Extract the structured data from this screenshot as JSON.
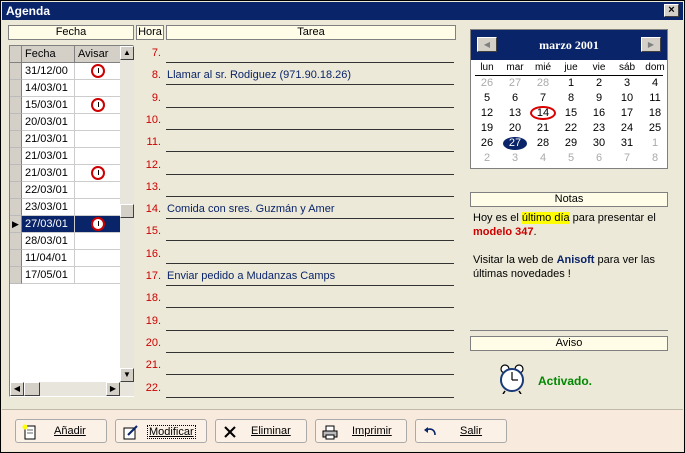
{
  "window": {
    "title": "Agenda",
    "close_label": "×"
  },
  "headers": {
    "fecha": "Fecha",
    "hora": "Hora",
    "tarea": "Tarea",
    "notas": "Notas",
    "aviso": "Aviso"
  },
  "list": {
    "col_fecha": "Fecha",
    "col_avisar": "Avisar",
    "rows": [
      {
        "date": "31/12/00",
        "alarm": true
      },
      {
        "date": "14/03/01",
        "alarm": false
      },
      {
        "date": "15/03/01",
        "alarm": true
      },
      {
        "date": "20/03/01",
        "alarm": false
      },
      {
        "date": "21/03/01",
        "alarm": false
      },
      {
        "date": "21/03/01",
        "alarm": false
      },
      {
        "date": "21/03/01",
        "alarm": true
      },
      {
        "date": "22/03/01",
        "alarm": false
      },
      {
        "date": "23/03/01",
        "alarm": false
      },
      {
        "date": "27/03/01",
        "alarm": true,
        "selected": true
      },
      {
        "date": "28/03/01",
        "alarm": false
      },
      {
        "date": "11/04/01",
        "alarm": false
      },
      {
        "date": "17/05/01",
        "alarm": false
      }
    ]
  },
  "tasks": [
    {
      "hour": "7.",
      "text": ""
    },
    {
      "hour": "8.",
      "text": "Llamar al sr. Rodiguez (971.90.18.26)"
    },
    {
      "hour": "9.",
      "text": ""
    },
    {
      "hour": "10.",
      "text": ""
    },
    {
      "hour": "11.",
      "text": ""
    },
    {
      "hour": "12.",
      "text": ""
    },
    {
      "hour": "13.",
      "text": ""
    },
    {
      "hour": "14.",
      "text": "Comida con sres. Guzmán y Amer"
    },
    {
      "hour": "15.",
      "text": ""
    },
    {
      "hour": "16.",
      "text": ""
    },
    {
      "hour": "17.",
      "text": "Enviar pedido a Mudanzas Camps"
    },
    {
      "hour": "18.",
      "text": ""
    },
    {
      "hour": "19.",
      "text": ""
    },
    {
      "hour": "20.",
      "text": ""
    },
    {
      "hour": "21.",
      "text": ""
    },
    {
      "hour": "22.",
      "text": ""
    }
  ],
  "calendar": {
    "title": "marzo 2001",
    "prev": "◀",
    "next": "▶",
    "dow": [
      "lun",
      "mar",
      "mié",
      "jue",
      "vie",
      "sáb",
      "dom"
    ],
    "weeks": [
      [
        {
          "d": "26",
          "o": true
        },
        {
          "d": "27",
          "o": true
        },
        {
          "d": "28",
          "o": true
        },
        {
          "d": "1"
        },
        {
          "d": "2"
        },
        {
          "d": "3"
        },
        {
          "d": "4"
        }
      ],
      [
        {
          "d": "5"
        },
        {
          "d": "6"
        },
        {
          "d": "7"
        },
        {
          "d": "8"
        },
        {
          "d": "9"
        },
        {
          "d": "10"
        },
        {
          "d": "11"
        }
      ],
      [
        {
          "d": "12"
        },
        {
          "d": "13"
        },
        {
          "d": "14",
          "today": true
        },
        {
          "d": "15"
        },
        {
          "d": "16"
        },
        {
          "d": "17"
        },
        {
          "d": "18"
        }
      ],
      [
        {
          "d": "19"
        },
        {
          "d": "20"
        },
        {
          "d": "21"
        },
        {
          "d": "22"
        },
        {
          "d": "23"
        },
        {
          "d": "24"
        },
        {
          "d": "25"
        }
      ],
      [
        {
          "d": "26"
        },
        {
          "d": "27",
          "selected": true
        },
        {
          "d": "28"
        },
        {
          "d": "29"
        },
        {
          "d": "30"
        },
        {
          "d": "31"
        },
        {
          "d": "1",
          "o": true
        }
      ],
      [
        {
          "d": "2",
          "o": true
        },
        {
          "d": "3",
          "o": true
        },
        {
          "d": "4",
          "o": true
        },
        {
          "d": "5",
          "o": true
        },
        {
          "d": "6",
          "o": true
        },
        {
          "d": "7",
          "o": true
        },
        {
          "d": "8",
          "o": true
        }
      ]
    ]
  },
  "notes": {
    "p1_a": "Hoy es el ",
    "p1_hl": "último día",
    "p1_b": " para presentar el ",
    "p1_model": "modelo 347",
    "p1_c": ".",
    "p2_a": "Visitar la web de ",
    "p2_brand": "Anisoft",
    "p2_b": " para ver las últimas novedades !"
  },
  "aviso": {
    "status": "Activado."
  },
  "toolbar": {
    "add": "Añadir",
    "modify": "Modificar",
    "delete": "Eliminar",
    "print": "Imprimir",
    "exit": "Salir"
  }
}
